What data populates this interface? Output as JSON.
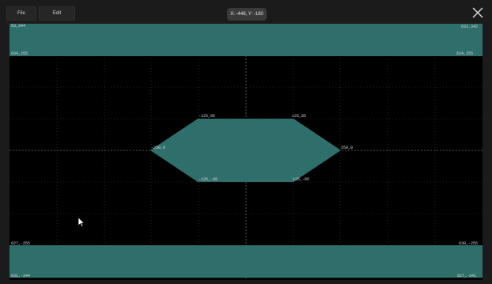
{
  "window": {
    "menu": {
      "file_label": "File",
      "edit_label": "Edit"
    },
    "coord_readout": "X: -448, Y: -180"
  },
  "canvas": {
    "colors": {
      "background": "#000000",
      "fill": "#2e6f6c",
      "grid": "#444444",
      "axis": "#6a6a6a"
    },
    "top_band": {
      "labels": {
        "top_left": "63,344",
        "top_right": "632,342",
        "bottom_left": "634,255",
        "bottom_right": "624,255"
      }
    },
    "bottom_band": {
      "labels": {
        "top_left": "627,-255",
        "top_right": "630,-255",
        "bottom_left": "631,-344",
        "bottom_right": "627,-341"
      }
    },
    "hexagon": {
      "labels": {
        "left": "-250,0",
        "top_left": "-125,85",
        "top_right": "125,85",
        "right": "250,0",
        "bottom_left": "-125,-85",
        "bottom_right": "125,-85"
      }
    }
  },
  "cursor": {
    "icon": "arrow-cursor-icon"
  }
}
